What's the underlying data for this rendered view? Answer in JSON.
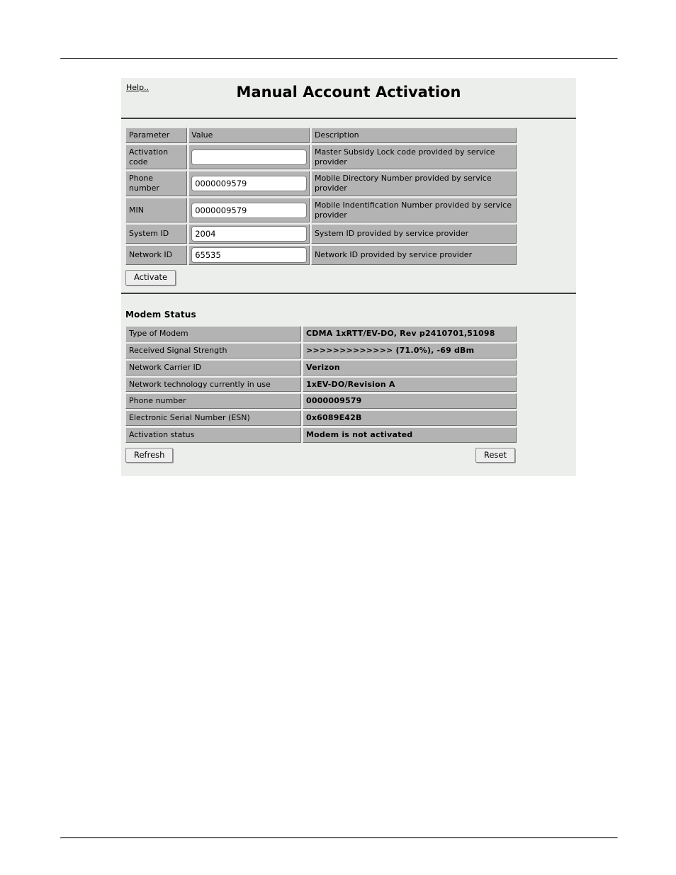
{
  "header": {
    "help_label": "Help..",
    "title": "Manual Account Activation"
  },
  "activation_form": {
    "columns": {
      "parameter": "Parameter",
      "value": "Value",
      "description": "Description"
    },
    "rows": [
      {
        "parameter": "Activation code",
        "value": "",
        "placeholder": "",
        "description": "Master Subsidy Lock code provided by service provider"
      },
      {
        "parameter": "Phone number",
        "value": "0000009579",
        "placeholder": "",
        "description": "Mobile Directory Number provided by service provider"
      },
      {
        "parameter": "MIN",
        "value": "0000009579",
        "placeholder": "",
        "description": "Mobile Indentification Number provided by service provider"
      },
      {
        "parameter": "System ID",
        "value": "2004",
        "placeholder": "",
        "description": "System ID provided by service provider"
      },
      {
        "parameter": "Network ID",
        "value": "65535",
        "placeholder": "",
        "description": "Network ID provided by service provider"
      }
    ],
    "activate_label": "Activate"
  },
  "modem_status": {
    "title": "Modem Status",
    "rows": [
      {
        "label": "Type of Modem",
        "value": "CDMA 1xRTT/EV-DO, Rev p2410701,51098"
      },
      {
        "label": "Received Signal Strength",
        "value": ">>>>>>>>>>>>> (71.0%), -69 dBm"
      },
      {
        "label": "Network Carrier ID",
        "value": "Verizon"
      },
      {
        "label": "Network technology currently in use",
        "value": "1xEV-DO/Revision A"
      },
      {
        "label": "Phone number",
        "value": "0000009579"
      },
      {
        "label": "Electronic Serial Number (ESN)",
        "value": "0x6089E42B"
      },
      {
        "label": "Activation status",
        "value": "Modem is not activated"
      }
    ],
    "refresh_label": "Refresh",
    "reset_label": "Reset"
  }
}
